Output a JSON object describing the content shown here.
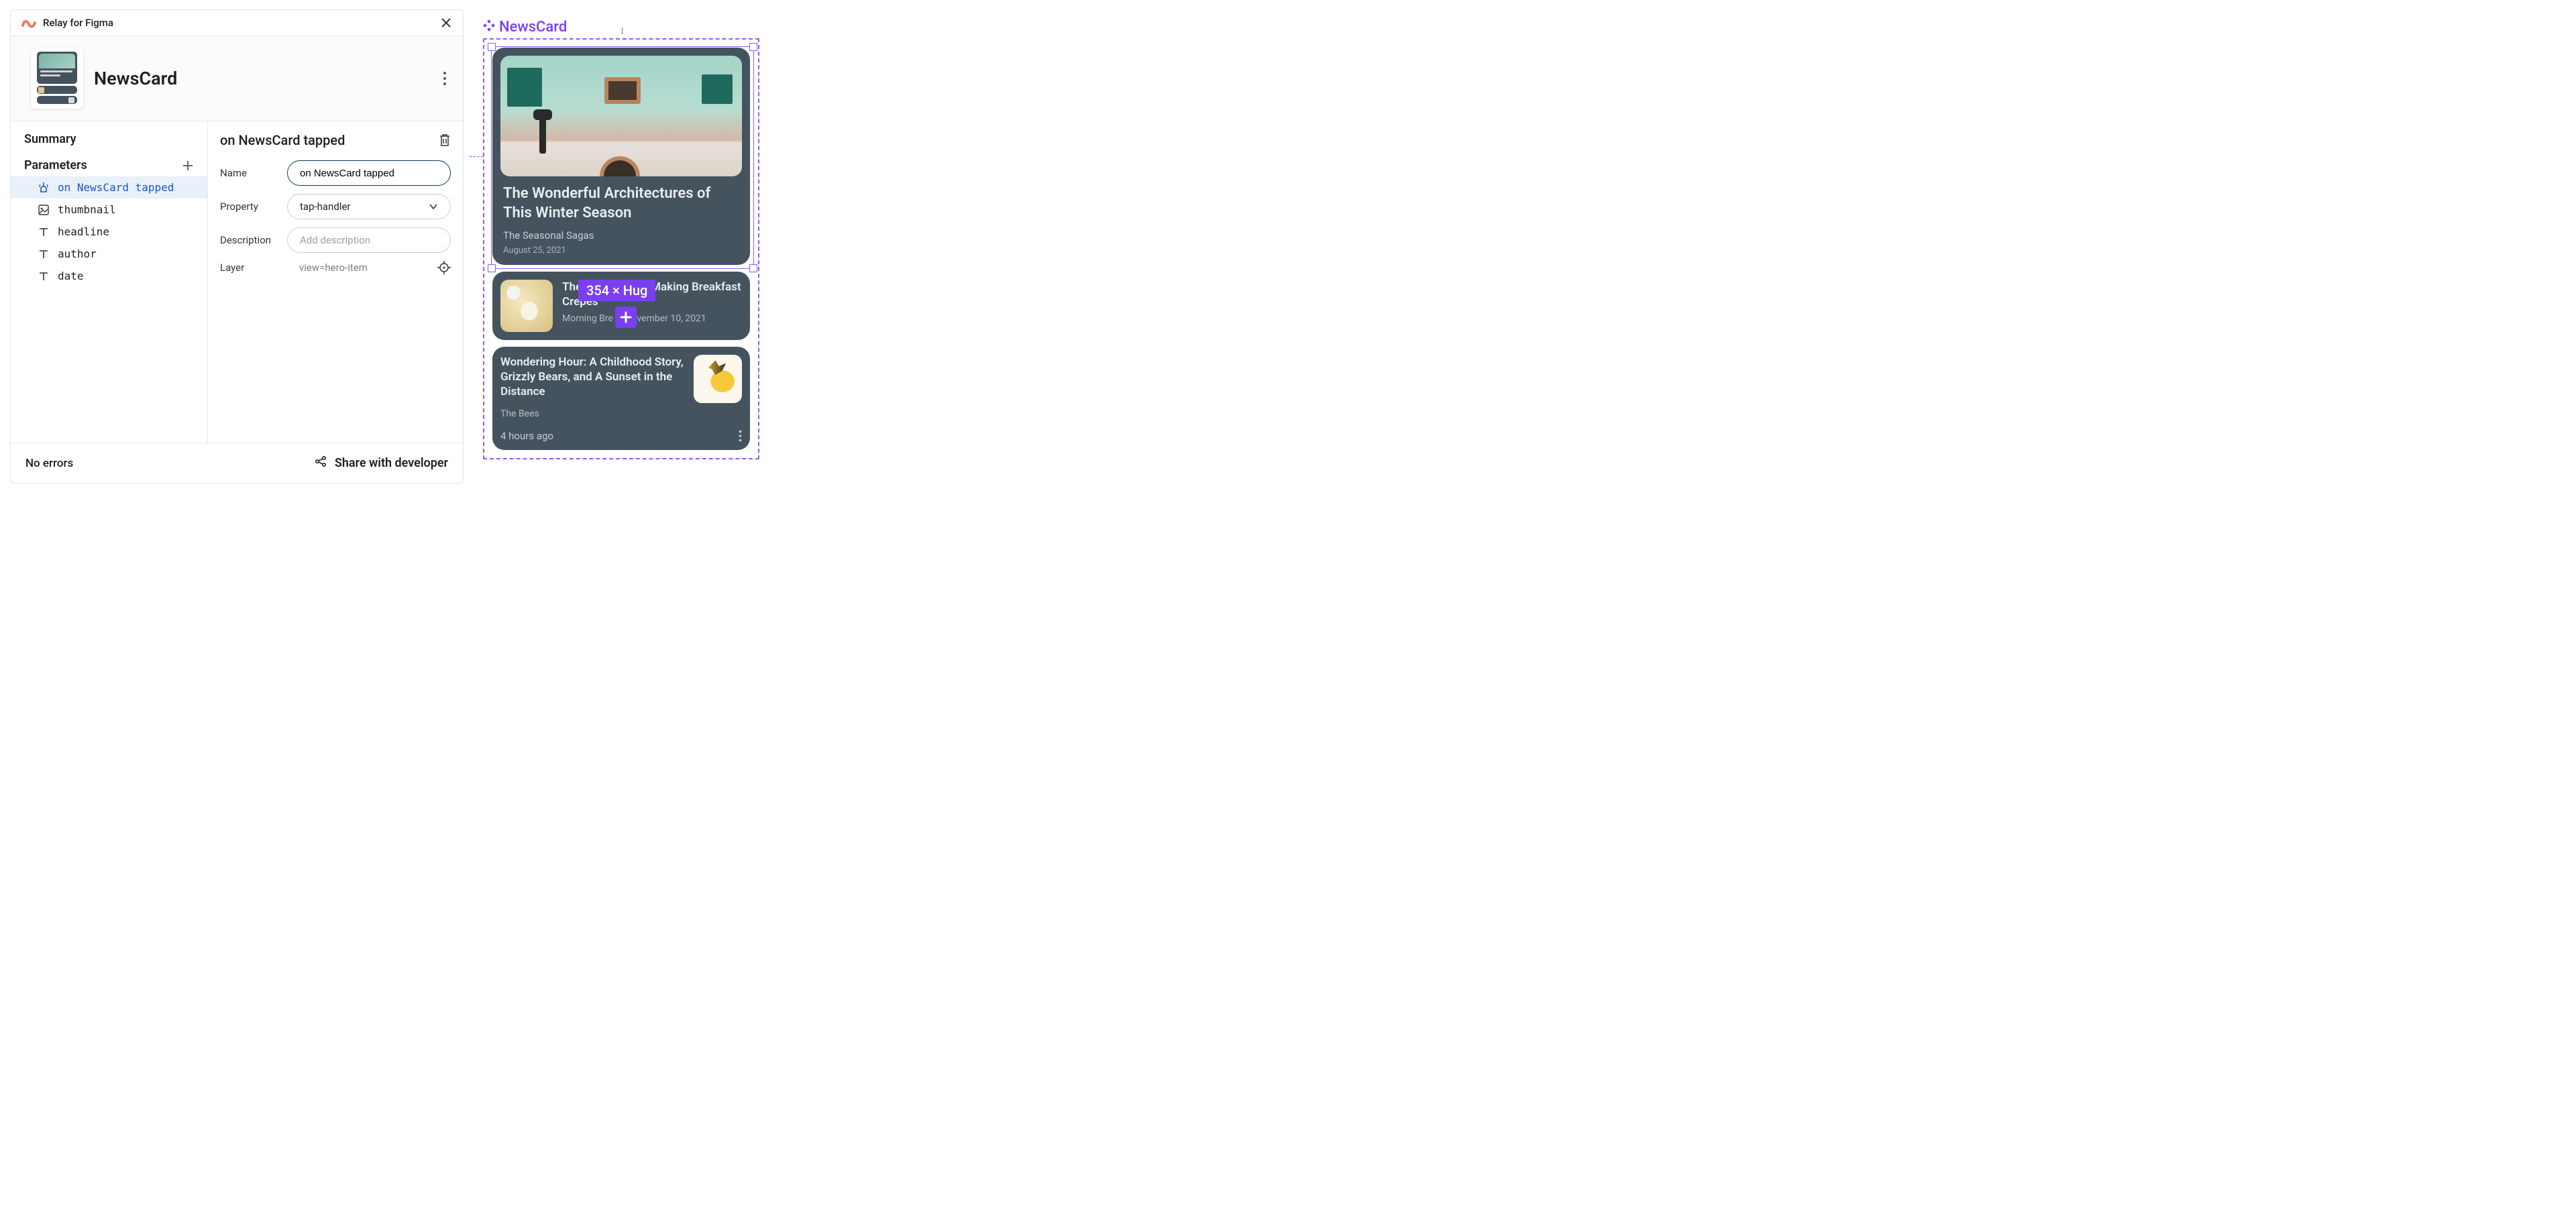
{
  "panel": {
    "brand": "Relay for Figma",
    "component_name": "NewsCard",
    "sidebar": {
      "summary_label": "Summary",
      "parameters_label": "Parameters",
      "params": [
        {
          "label": "on NewsCard tapped",
          "icon": "tap"
        },
        {
          "label": "thumbnail",
          "icon": "image"
        },
        {
          "label": "headline",
          "icon": "text"
        },
        {
          "label": "author",
          "icon": "text"
        },
        {
          "label": "date",
          "icon": "text"
        }
      ]
    },
    "detail": {
      "title": "on NewsCard tapped",
      "name_label": "Name",
      "name_value": "on NewsCard tapped",
      "property_label": "Property",
      "property_value": "tap-handler",
      "description_label": "Description",
      "description_placeholder": "Add description",
      "layer_label": "Layer",
      "layer_value": "view=hero-item"
    },
    "footer": {
      "status": "No errors",
      "share": "Share with developer"
    }
  },
  "canvas": {
    "component_label": "NewsCard",
    "dimension_badge": "354 × Hug",
    "cards": {
      "hero": {
        "headline": "The Wonderful Architectures of This Winter Season",
        "author": "The Seasonal Sagas",
        "date": "August 25, 2021"
      },
      "row": {
        "headline_prefix": "The",
        "headline_suffix": "Making Breakfast Crepes",
        "meta_prefix": "Morning Bre",
        "meta_suffix": "ovember 10, 2021"
      },
      "col": {
        "headline": "Wondering Hour: A Childhood Story, Grizzly Bears, and A Sunset in the Distance",
        "author": "The Bees",
        "time": "4 hours ago"
      }
    }
  }
}
